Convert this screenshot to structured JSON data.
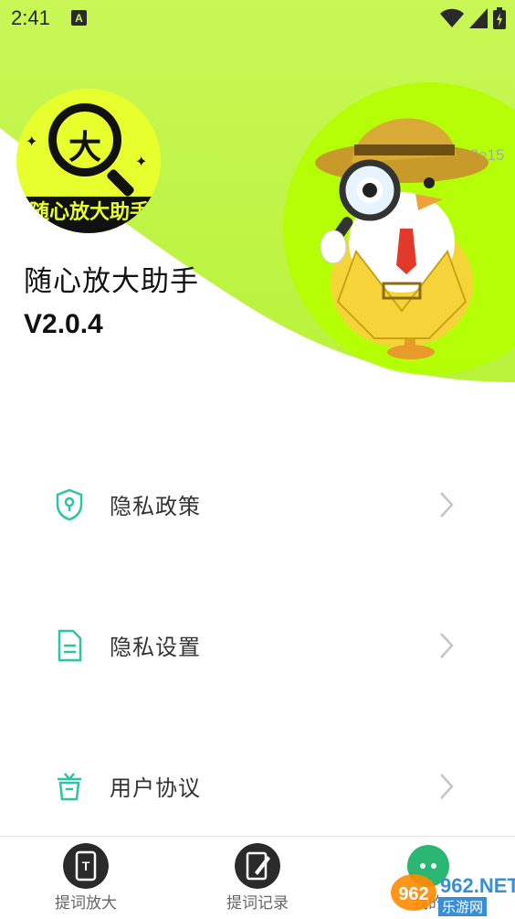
{
  "status_bar": {
    "time": "2:41",
    "notif_letter": "A"
  },
  "header": {
    "logo_char": "大",
    "logo_text": "随心放大助手",
    "app_name": "随心放大助手",
    "app_version": "V2.0.4",
    "partial_code": "30e15"
  },
  "menu": [
    {
      "label": "隐私政策",
      "icon": "shield-icon"
    },
    {
      "label": "隐私设置",
      "icon": "document-icon"
    },
    {
      "label": "用户协议",
      "icon": "gift-icon"
    }
  ],
  "bottom_nav": [
    {
      "label": "提词放大",
      "icon": "t-icon"
    },
    {
      "label": "提词记录",
      "icon": "edit-icon"
    },
    {
      "label": "我的",
      "icon": "chat-icon"
    }
  ],
  "watermark": {
    "text": "962.NET",
    "sub": "乐游网"
  },
  "colors": {
    "accent": "#c8f542",
    "teal": "#2bc4a4",
    "dark": "#2a2a2a"
  }
}
